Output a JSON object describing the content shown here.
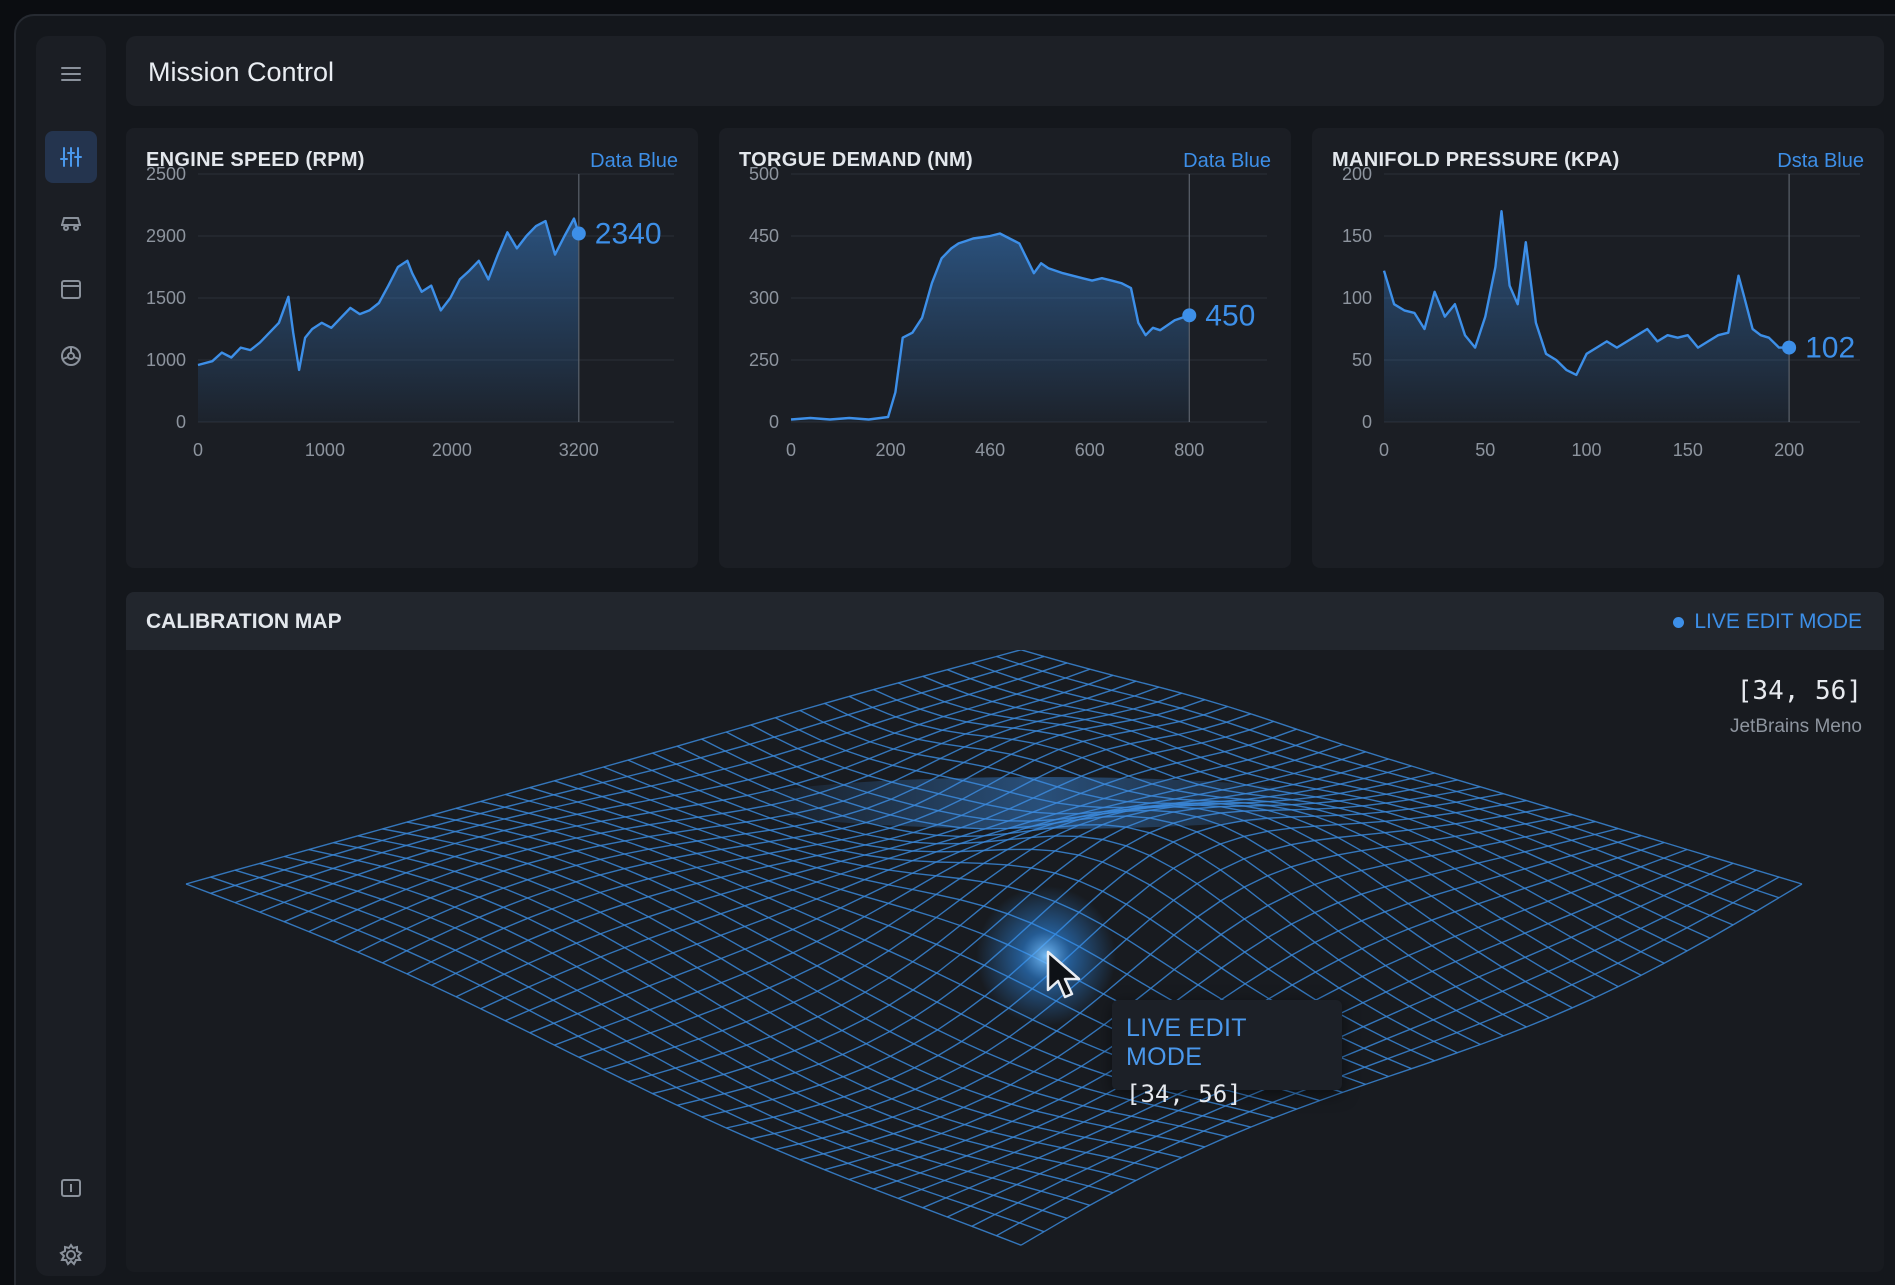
{
  "app": {
    "title": "Mission Control"
  },
  "sidebar": {
    "items": [
      {
        "name": "menu",
        "icon": "hamburger-menu-icon"
      },
      {
        "name": "dashboard",
        "icon": "gauges-icon",
        "active": true
      },
      {
        "name": "vehicle",
        "icon": "car-icon"
      },
      {
        "name": "calendar",
        "icon": "calendar-icon"
      },
      {
        "name": "engine",
        "icon": "engine-icon"
      },
      {
        "name": "info",
        "icon": "info-panel-icon"
      },
      {
        "name": "settings",
        "icon": "gear-icon"
      }
    ]
  },
  "colors": {
    "accent": "#3d8fe8",
    "background": "#14171c",
    "panel": "#1b1e24"
  },
  "charts": [
    {
      "title": "ENGINE SPEED (RPM)",
      "tag": "Data Blue",
      "current_value": "2340",
      "chart_data": {
        "type": "area",
        "x_ticks": [
          "0",
          "1000",
          "2000",
          "3200"
        ],
        "y_ticks": [
          "0",
          "1000",
          "1500",
          "2900",
          "2500"
        ],
        "ylim": [
          0,
          2000
        ],
        "xlim": [
          0,
          4000
        ],
        "cursor_x": 3200,
        "x": [
          0,
          120,
          200,
          280,
          360,
          440,
          520,
          600,
          680,
          760,
          800,
          850,
          900,
          960,
          1040,
          1120,
          1200,
          1280,
          1360,
          1440,
          1520,
          1600,
          1680,
          1760,
          1800,
          1880,
          1960,
          2040,
          2120,
          2200,
          2280,
          2360,
          2440,
          2520,
          2600,
          2680,
          2760,
          2840,
          2920,
          3000,
          3080,
          3160,
          3200
        ],
        "y": [
          460,
          490,
          560,
          520,
          600,
          580,
          640,
          720,
          800,
          1010,
          720,
          420,
          680,
          750,
          800,
          760,
          840,
          920,
          870,
          900,
          960,
          1100,
          1250,
          1300,
          1200,
          1050,
          1100,
          900,
          1000,
          1150,
          1220,
          1300,
          1150,
          1350,
          1530,
          1400,
          1500,
          1580,
          1620,
          1350,
          1500,
          1640,
          1520
        ]
      }
    },
    {
      "title": "TORGUE DEMAND (NM)",
      "tag": "Data Blue",
      "current_value": "450",
      "chart_data": {
        "type": "area",
        "x_ticks": [
          "0",
          "200",
          "460",
          "600",
          "800"
        ],
        "y_ticks": [
          "0",
          "250",
          "300",
          "450",
          "500"
        ],
        "ylim": [
          0,
          500
        ],
        "xlim": [
          0,
          980
        ],
        "cursor_x": 820,
        "x": [
          0,
          40,
          80,
          120,
          160,
          200,
          215,
          230,
          250,
          270,
          290,
          310,
          330,
          345,
          360,
          375,
          390,
          410,
          430,
          450,
          470,
          485,
          500,
          515,
          530,
          545,
          560,
          580,
          600,
          620,
          640,
          660,
          680,
          700,
          715,
          730,
          745,
          760,
          775,
          790,
          805,
          820
        ],
        "y": [
          5,
          8,
          5,
          8,
          5,
          10,
          60,
          170,
          180,
          210,
          280,
          330,
          350,
          360,
          365,
          370,
          372,
          375,
          380,
          370,
          360,
          330,
          300,
          320,
          310,
          305,
          300,
          295,
          290,
          285,
          290,
          285,
          280,
          270,
          200,
          175,
          190,
          185,
          195,
          205,
          210,
          215
        ]
      }
    },
    {
      "title": "MANIFOLD PRESSURE (KPA)",
      "tag": "Dsta Blue",
      "current_value": "102",
      "chart_data": {
        "type": "area",
        "x_ticks": [
          "0",
          "50",
          "100",
          "150",
          "200"
        ],
        "y_ticks": [
          "0",
          "50",
          "100",
          "150",
          "200"
        ],
        "ylim": [
          0,
          200
        ],
        "xlim": [
          0,
          235
        ],
        "cursor_x": 200,
        "x": [
          0,
          5,
          10,
          15,
          20,
          25,
          30,
          35,
          40,
          45,
          50,
          55,
          58,
          62,
          66,
          70,
          75,
          80,
          85,
          90,
          95,
          100,
          105,
          110,
          115,
          120,
          125,
          130,
          135,
          140,
          145,
          150,
          155,
          160,
          165,
          170,
          175,
          178,
          182,
          186,
          190,
          195,
          200
        ],
        "y": [
          122,
          95,
          90,
          88,
          75,
          105,
          85,
          95,
          70,
          60,
          85,
          125,
          170,
          110,
          95,
          145,
          80,
          55,
          50,
          42,
          38,
          55,
          60,
          65,
          60,
          65,
          70,
          75,
          65,
          70,
          68,
          70,
          60,
          65,
          70,
          72,
          118,
          100,
          75,
          70,
          68,
          60,
          60
        ]
      }
    }
  ],
  "calibration": {
    "title": "CALIBRATION MAP",
    "live_label": "LIVE EDIT MODE",
    "coord": "[34, 56]",
    "coord_font": "JetBrains Meno",
    "tooltip_title": "LIVE EDIT MODE",
    "tooltip_value": "[34, 56]"
  }
}
